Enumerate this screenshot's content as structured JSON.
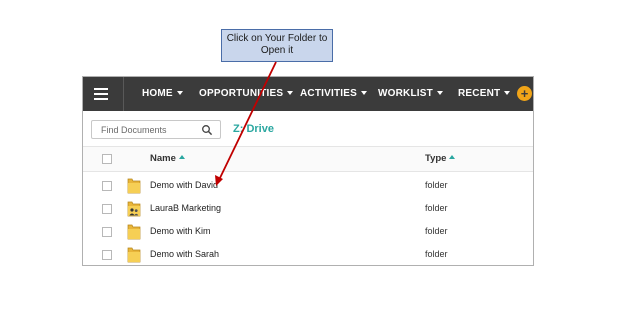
{
  "callout": {
    "line1": "Click on Your Folder to",
    "line2": "Open it"
  },
  "nav": {
    "items": [
      {
        "label": "HOME",
        "dropdown": true
      },
      {
        "label": "OPPORTUNITIES",
        "dropdown": true
      },
      {
        "label": "ACTIVITIES",
        "dropdown": true
      },
      {
        "label": "WORKLIST",
        "dropdown": true
      },
      {
        "label": "RECENT",
        "dropdown": true
      }
    ],
    "add_button": "+"
  },
  "search": {
    "placeholder": "Find Documents",
    "value": ""
  },
  "drive_label": "Z: Drive",
  "columns": {
    "name": "Name",
    "type": "Type"
  },
  "rows": [
    {
      "name": "Demo with David",
      "type": "folder",
      "icon": "folder-icon"
    },
    {
      "name": "LauraB Marketing",
      "type": "folder",
      "icon": "shared-folder-icon"
    },
    {
      "name": "Demo with Kim",
      "type": "folder",
      "icon": "folder-icon"
    },
    {
      "name": "Demo with Sarah",
      "type": "folder",
      "icon": "folder-icon"
    }
  ],
  "colors": {
    "navbar": "#3b3b3b",
    "accent_teal": "#2aa7a0",
    "add_button": "#f0a418",
    "annotation_arrow": "#c00000",
    "callout_fill": "#c9d6ec"
  }
}
